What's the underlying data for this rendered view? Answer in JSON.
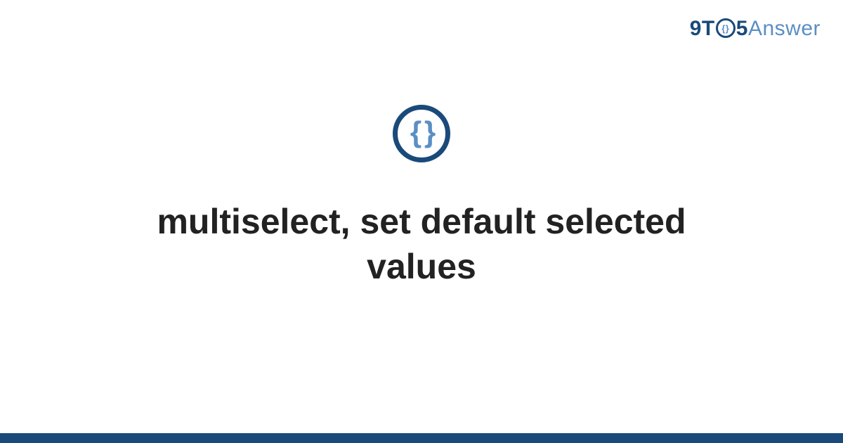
{
  "brand": {
    "part1": "9T",
    "o_inner": "{}",
    "part2": "5",
    "part3": "Answer"
  },
  "icon": {
    "name": "braces-icon",
    "glyph": "{ }"
  },
  "main": {
    "title": "multiselect, set default selected values"
  },
  "colors": {
    "primary_dark": "#1a4a7a",
    "primary_light": "#5b8ec4",
    "text": "#222222",
    "background": "#ffffff"
  }
}
